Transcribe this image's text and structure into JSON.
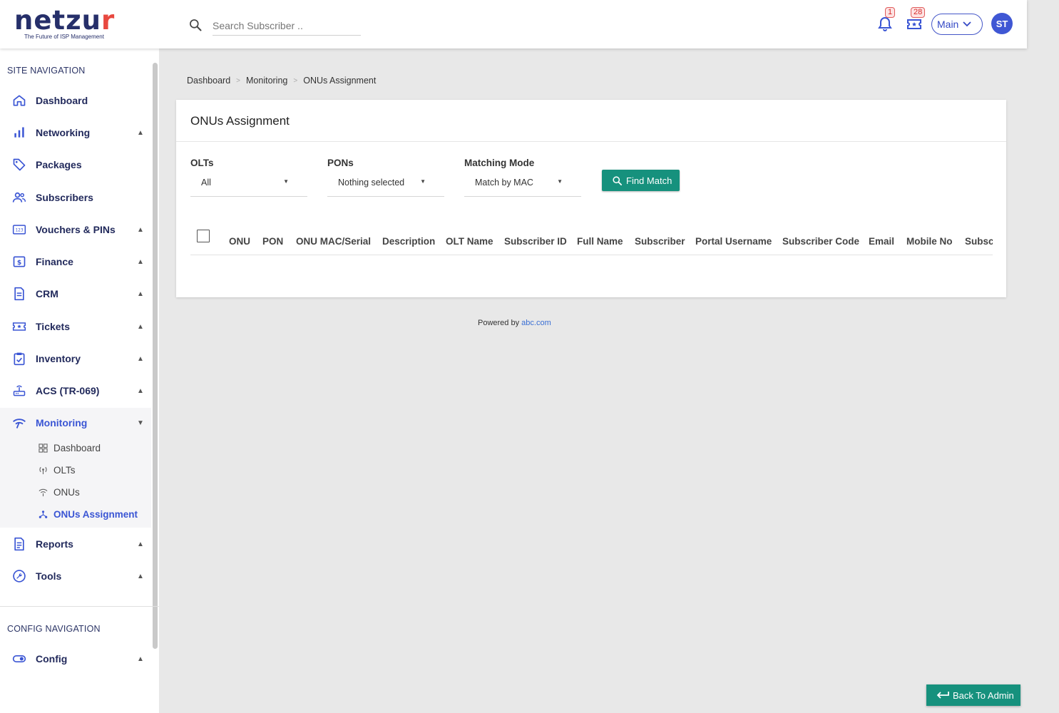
{
  "brand": {
    "name_main": "netzu",
    "name_accent": "r",
    "tagline": "The Future of ISP Management"
  },
  "header": {
    "search_placeholder": "Search Subscriber ..",
    "notifications_count": "1",
    "tickets_count": "28",
    "context_select": "Main",
    "avatar_initials": "ST"
  },
  "sidebar": {
    "site_title": "SITE NAVIGATION",
    "items": [
      {
        "label": "Dashboard",
        "icon": "home-icon",
        "expandable": false
      },
      {
        "label": "Networking",
        "icon": "bar-chart-icon",
        "expandable": true
      },
      {
        "label": "Packages",
        "icon": "tag-icon",
        "expandable": false
      },
      {
        "label": "Subscribers",
        "icon": "users-icon",
        "expandable": false
      },
      {
        "label": "Vouchers & PINs",
        "icon": "voucher-icon",
        "expandable": true
      },
      {
        "label": "Finance",
        "icon": "dollar-icon",
        "expandable": true
      },
      {
        "label": "CRM",
        "icon": "document-icon",
        "expandable": true
      },
      {
        "label": "Tickets",
        "icon": "ticket-icon",
        "expandable": true
      },
      {
        "label": "Inventory",
        "icon": "clipboard-icon",
        "expandable": true
      },
      {
        "label": "ACS (TR-069)",
        "icon": "router-icon",
        "expandable": true
      },
      {
        "label": "Monitoring",
        "icon": "signal-icon",
        "expandable": true,
        "expanded": true
      },
      {
        "label": "Reports",
        "icon": "report-icon",
        "expandable": true
      },
      {
        "label": "Tools",
        "icon": "wrench-icon",
        "expandable": true
      }
    ],
    "monitoring_sub": [
      {
        "label": "Dashboard",
        "icon": "grid-icon"
      },
      {
        "label": "OLTs",
        "icon": "antenna-icon"
      },
      {
        "label": "ONUs",
        "icon": "wifi-icon"
      },
      {
        "label": "ONUs Assignment",
        "icon": "share-icon",
        "active": true
      }
    ],
    "config_title": "CONFIG NAVIGATION",
    "config_items": [
      {
        "label": "Config",
        "icon": "toggle-icon",
        "expandable": true
      }
    ]
  },
  "breadcrumb": [
    "Dashboard",
    "Monitoring",
    "ONUs Assignment"
  ],
  "card": {
    "title": "ONUs Assignment",
    "filters": {
      "olts": {
        "label": "OLTs",
        "value": "All"
      },
      "pons": {
        "label": "PONs",
        "value": "Nothing selected"
      },
      "mode": {
        "label": "Matching Mode",
        "value": "Match by MAC"
      }
    },
    "find_button": "Find Match",
    "columns": [
      "ONU",
      "PON",
      "ONU MAC/Serial",
      "Description",
      "OLT Name",
      "Subscriber ID",
      "Full Name",
      "Subscriber",
      "Portal Username",
      "Subscriber Code",
      "Email",
      "Mobile No",
      "Subscr"
    ]
  },
  "footer": {
    "powered_by": "Powered by",
    "link": "abc.com"
  },
  "back_button": "Back To Admin",
  "colors": {
    "primary": "#3a55d4",
    "navy": "#222a5c",
    "teal": "#16917d",
    "badge_red": "#d62a2a"
  }
}
